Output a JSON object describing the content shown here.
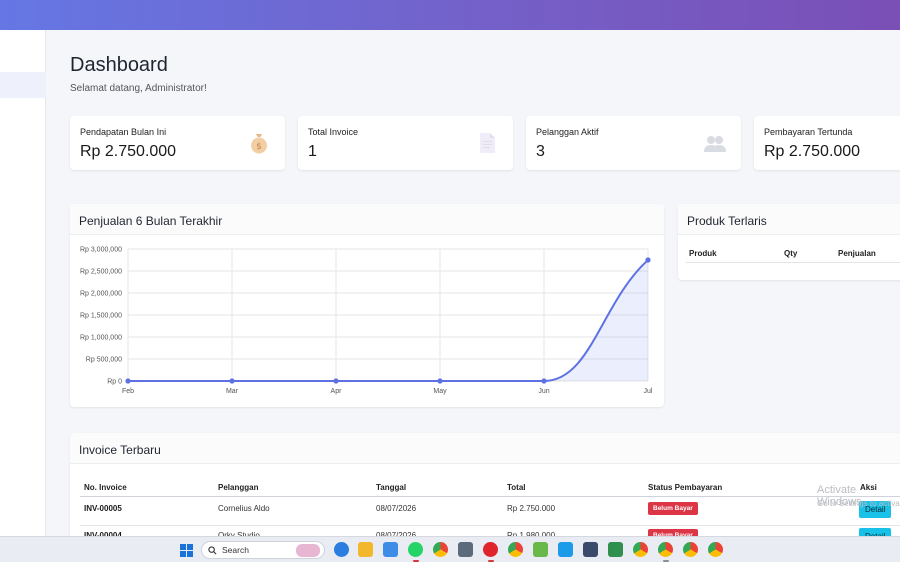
{
  "page": {
    "title": "Dashboard",
    "subtitle": "Selamat datang, Administrator!"
  },
  "stats": [
    {
      "label": "Pendapatan Bulan Ini",
      "value": "Rp 2.750.000",
      "icon": "money-bag-icon"
    },
    {
      "label": "Total Invoice",
      "value": "1",
      "icon": "document-icon"
    },
    {
      "label": "Pelanggan Aktif",
      "value": "3",
      "icon": "users-icon"
    },
    {
      "label": "Pembayaran Tertunda",
      "value": "Rp 2.750.000",
      "icon": "clock-icon"
    }
  ],
  "sales_chart": {
    "title": "Penjualan 6 Bulan Terakhir"
  },
  "chart_data": {
    "type": "area",
    "categories": [
      "Feb",
      "Mar",
      "Apr",
      "May",
      "Jun",
      "Jul"
    ],
    "values": [
      0,
      0,
      0,
      0,
      0,
      2750000
    ],
    "ylim": [
      0,
      3000000
    ],
    "yticks": [
      0,
      500000,
      1000000,
      1500000,
      2000000,
      2500000,
      3000000
    ],
    "ytick_labels": [
      "Rp 0",
      "Rp 500,000",
      "Rp 1,000,000",
      "Rp 1,500,000",
      "Rp 2,000,000",
      "Rp 2,500,000",
      "Rp 3,000,000"
    ],
    "grid": true,
    "color": "#5e72e4"
  },
  "top_products": {
    "title": "Produk Terlaris",
    "columns": [
      "Produk",
      "Qty",
      "Penjualan"
    ]
  },
  "recent_invoices": {
    "title": "Invoice Terbaru",
    "columns": [
      "No. Invoice",
      "Pelanggan",
      "Tanggal",
      "Total",
      "Status Pembayaran",
      "Aksi"
    ],
    "rows": [
      {
        "no": "INV-00005",
        "customer": "Cornelius Aldo",
        "date": "08/07/2026",
        "total": "Rp 2.750.000",
        "status": "Belum Bayar",
        "action": "Detail"
      },
      {
        "no": "INV-00004",
        "customer": "Orky Studio",
        "date": "08/07/2026",
        "total": "Rp 1.980.000",
        "status": "Belum Bayar",
        "action": "Detail"
      }
    ]
  },
  "watermark": {
    "line1": "Activate Windows",
    "line2": "Go to Settings to activate Windows."
  },
  "taskbar": {
    "search_placeholder": "Search"
  }
}
